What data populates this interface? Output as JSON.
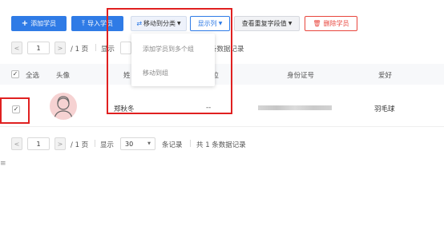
{
  "toolbar": {
    "add_student": "添加学员",
    "import_student": "导入学员",
    "move_to_category": "移动到分类",
    "show_columns": "显示列",
    "view_duplicates": "查看重复字段值",
    "delete_student": "删除学员"
  },
  "dropdown": {
    "items": [
      "添加学员到多个组",
      "移动到组"
    ]
  },
  "pager_top": {
    "page_value": "1",
    "page_total": "/ 1 页",
    "show_label": "显示",
    "records_tail": "条数据记录"
  },
  "table": {
    "headers": {
      "select_all": "全选",
      "avatar": "头像",
      "name": "姓",
      "position": "职位",
      "id_number": "身份证号",
      "hobby": "爱好"
    },
    "rows": [
      {
        "checked": true,
        "name": "郑秋冬",
        "position": "--",
        "id_number": "",
        "hobby": "羽毛球"
      }
    ]
  },
  "pager_bottom": {
    "page_value": "1",
    "page_total": "/ 1 页",
    "show_label": "显示",
    "page_size": "30",
    "records_label": "条记录",
    "total_text": "共 1 条数据记录"
  },
  "colors": {
    "accent": "#2f7be6",
    "danger": "#e8453c",
    "highlight": "#e02020"
  }
}
